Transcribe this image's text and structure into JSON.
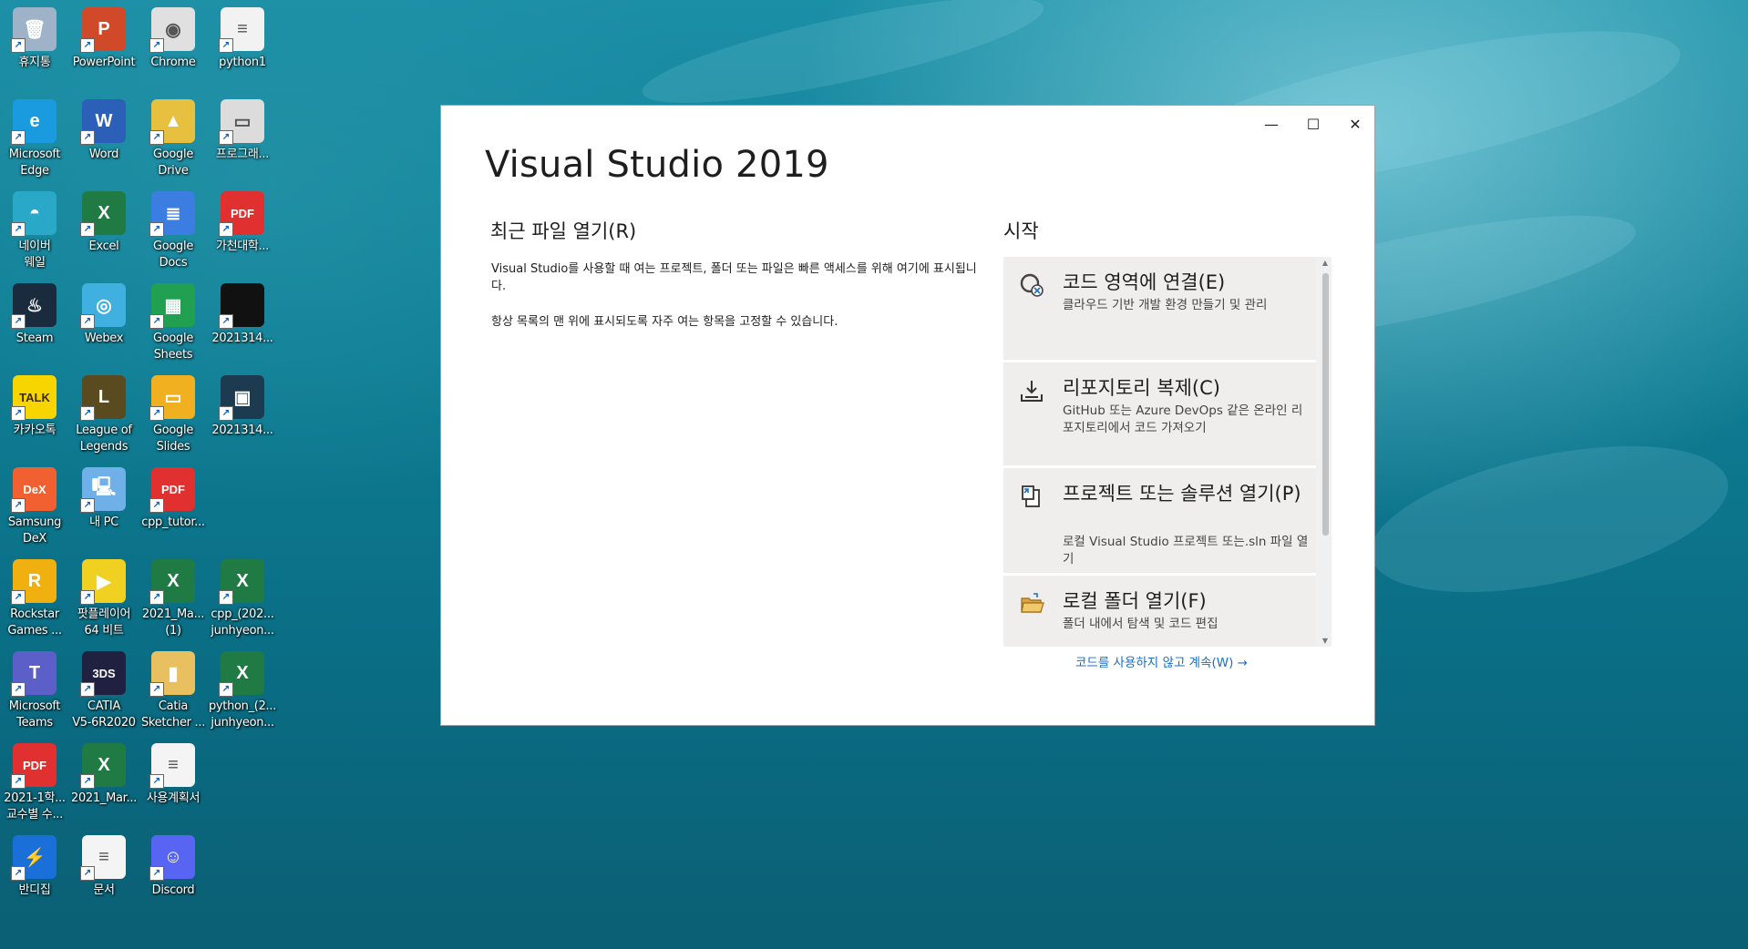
{
  "desktop": {
    "icons": [
      {
        "label": "휴지통",
        "icon": "recycle-bin-icon",
        "color": "#9fb3c8",
        "glyph": "🗑"
      },
      {
        "label": "PowerPoint",
        "icon": "powerpoint-icon",
        "color": "#d04a2a",
        "glyph": "P"
      },
      {
        "label": "Chrome",
        "icon": "chrome-icon",
        "color": "#e0e0e0",
        "glyph": "◉"
      },
      {
        "label": "python1",
        "icon": "document-icon",
        "color": "#f2f2f2",
        "glyph": "≡"
      },
      {
        "label": "Microsoft\nEdge",
        "icon": "edge-icon",
        "color": "#1a9be0",
        "glyph": "e"
      },
      {
        "label": "Word",
        "icon": "word-icon",
        "color": "#2b5fb8",
        "glyph": "W"
      },
      {
        "label": "Google\nDrive",
        "icon": "google-drive-icon",
        "color": "#e8c040",
        "glyph": "▲"
      },
      {
        "label": "프로그래...",
        "icon": "window-icon",
        "color": "#dcdcdc",
        "glyph": "▭"
      },
      {
        "label": "네이버\n웨일",
        "icon": "whale-icon",
        "color": "#2aa8c8",
        "glyph": "◓"
      },
      {
        "label": "Excel",
        "icon": "excel-icon",
        "color": "#1f7a44",
        "glyph": "X"
      },
      {
        "label": "Google\nDocs",
        "icon": "google-docs-icon",
        "color": "#3b7de0",
        "glyph": "≣"
      },
      {
        "label": "가천대학...",
        "icon": "pdf-icon",
        "color": "#e03030",
        "glyph": "PDF"
      },
      {
        "label": "Steam",
        "icon": "steam-icon",
        "color": "#1b2b3e",
        "glyph": "♨"
      },
      {
        "label": "Webex",
        "icon": "webex-icon",
        "color": "#3fb0e0",
        "glyph": "◎"
      },
      {
        "label": "Google\nSheets",
        "icon": "google-sheets-icon",
        "color": "#20a050",
        "glyph": "▦"
      },
      {
        "label": "2021314...",
        "icon": "image-icon",
        "color": "#111111",
        "glyph": ""
      },
      {
        "label": "카카오톡",
        "icon": "kakaotalk-icon",
        "color": "#f7d500",
        "glyph": "TALK"
      },
      {
        "label": "League of\nLegends",
        "icon": "league-icon",
        "color": "#5a4a20",
        "glyph": "L"
      },
      {
        "label": "Google\nSlides",
        "icon": "google-slides-icon",
        "color": "#f0b020",
        "glyph": "▭"
      },
      {
        "label": "2021314...",
        "icon": "video-icon",
        "color": "#1c3a50",
        "glyph": "▣"
      },
      {
        "label": "Samsung\nDeX",
        "icon": "dex-icon",
        "color": "#f06030",
        "glyph": "DeX"
      },
      {
        "label": "내 PC",
        "icon": "computer-icon",
        "color": "#6fb0e8",
        "glyph": "🖳"
      },
      {
        "label": "cpp_tutor...",
        "icon": "pdf-icon",
        "color": "#e03030",
        "glyph": "PDF"
      },
      {
        "label": "",
        "icon": "",
        "color": "",
        "glyph": ""
      },
      {
        "label": "Rockstar\nGames ...",
        "icon": "rockstar-icon",
        "color": "#f0b010",
        "glyph": "R"
      },
      {
        "label": "팟플레이어\n64 비트",
        "icon": "potplayer-icon",
        "color": "#f0d020",
        "glyph": "▶"
      },
      {
        "label": "2021_Ma...\n(1)",
        "icon": "excel-file-icon",
        "color": "#1f7a44",
        "glyph": "X"
      },
      {
        "label": "cpp_(202...\njunhyeon...",
        "icon": "excel-file-icon",
        "color": "#1f7a44",
        "glyph": "X"
      },
      {
        "label": "Microsoft\nTeams",
        "icon": "teams-icon",
        "color": "#5b5fc7",
        "glyph": "T"
      },
      {
        "label": "CATIA\nV5-6R2020",
        "icon": "catia-icon",
        "color": "#202040",
        "glyph": "3DS"
      },
      {
        "label": "Catia\nSketcher ...",
        "icon": "folder-icon",
        "color": "#e8c060",
        "glyph": "▮"
      },
      {
        "label": "python_(2...\njunhyeon...",
        "icon": "excel-file-icon",
        "color": "#1f7a44",
        "glyph": "X"
      },
      {
        "label": "2021-1학...\n교수별 수...",
        "icon": "pdf-icon",
        "color": "#e03030",
        "glyph": "PDF"
      },
      {
        "label": "2021_Mar...",
        "icon": "excel-file-icon",
        "color": "#1f7a44",
        "glyph": "X"
      },
      {
        "label": "사용계획서",
        "icon": "document-icon",
        "color": "#f4f4f4",
        "glyph": "≡"
      },
      {
        "label": "",
        "icon": "",
        "color": "",
        "glyph": ""
      },
      {
        "label": "반디집",
        "icon": "bandizip-icon",
        "color": "#1a70d8",
        "glyph": "⚡"
      },
      {
        "label": "문서",
        "icon": "document-icon",
        "color": "#f4f4f4",
        "glyph": "≡"
      },
      {
        "label": "Discord",
        "icon": "discord-icon",
        "color": "#5865f2",
        "glyph": "☺"
      }
    ]
  },
  "window": {
    "title": "Visual Studio 2019",
    "minimize": "—",
    "maximize": "☐",
    "close": "✕",
    "recent_heading": "최근 파일 열기(R)",
    "recent_desc1": "Visual Studio를 사용할 때 여는 프로젝트, 폴더 또는 파일은 빠른 액세스를 위해 여기에 표시됩니다.",
    "recent_desc2": "항상 목록의 맨 위에 표시되도록 자주 여는 항목을 고정할 수 있습니다.",
    "start_heading": "시작",
    "cards": [
      {
        "title": "코드 영역에 연결(E)",
        "desc": "클라우드 기반 개발 환경 만들기 및 관리",
        "icon": "codespace-icon"
      },
      {
        "title": "리포지토리 복제(C)",
        "desc": "GitHub 또는 Azure DevOps 같은 온라인 리포지토리에서 코드 가져오기",
        "icon": "clone-download-icon"
      },
      {
        "title": "프로젝트 또는 솔루션 열기(P)",
        "desc": "로컬 Visual Studio 프로젝트 또는.sln 파일 열기",
        "icon": "open-project-icon"
      },
      {
        "title": "로컬 폴더 열기(F)",
        "desc": "폴더 내에서 탐색 및 코드 편집",
        "icon": "open-folder-icon"
      }
    ],
    "continue_link": "코드를 사용하지 않고 계속(W) →"
  }
}
